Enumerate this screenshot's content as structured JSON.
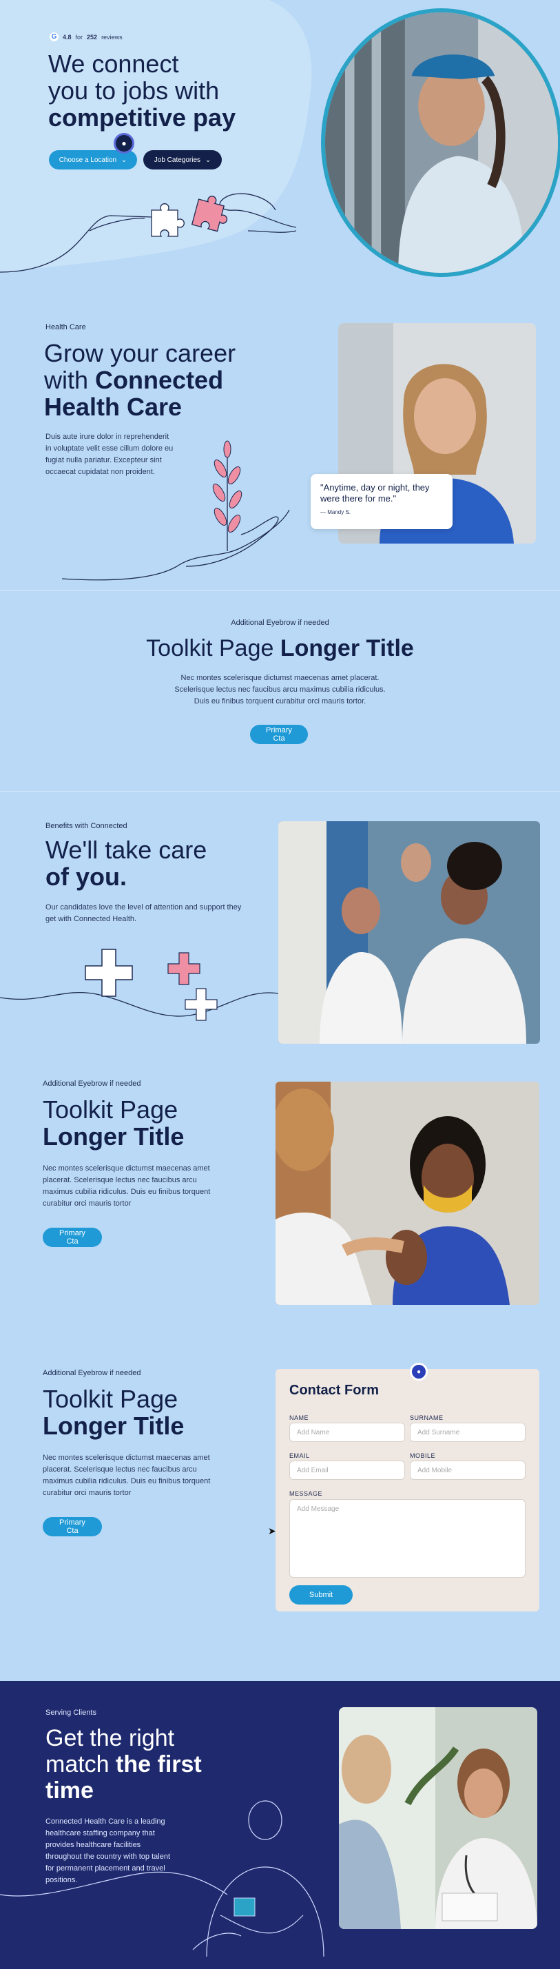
{
  "hero": {
    "rating": {
      "score": "4.8",
      "for_text": "for",
      "count": "252",
      "reviews_text": "reviews"
    },
    "title_line1": "We connect",
    "title_line2": "you to jobs with",
    "title_bold": "competitive pay",
    "location_button": "Choose a Location",
    "categories_button": "Job Categories"
  },
  "health": {
    "eyebrow": "Health Care",
    "title_line1": "Grow your career",
    "title_with": "with",
    "title_bold1": "Connected",
    "title_bold2": "Health Care",
    "body": "Duis aute irure dolor in reprehenderit in voluptate velit esse cillum dolore eu fugiat nulla pariatur. Excepteur sint occaecat cupidatat non proident.",
    "quote": "\"Anytime, day or night, they were there for me.\"",
    "quote_author": "— Mandy S."
  },
  "toolkit_center": {
    "eyebrow": "Additional Eyebrow if needed",
    "title_regular": "Toolkit Page",
    "title_bold": "Longer Title",
    "body_line1": "Nec montes scelerisque dictumst maecenas amet placerat.",
    "body_line2": "Scelerisque lectus nec faucibus arcu maximus cubilia ridiculus.",
    "body_line3": "Duis eu finibus torquent curabitur orci mauris tortor.",
    "cta": "Primary Cta"
  },
  "benefits": {
    "eyebrow": "Benefits with Connected",
    "title_line1": "We'll take care",
    "title_bold": "of you.",
    "body": "Our candidates love the level of attention and support they get with Connected Health."
  },
  "toolkit_left": {
    "eyebrow": "Additional Eyebrow if needed",
    "title_regular": "Toolkit Page",
    "title_bold": "Longer Title",
    "body": "Nec montes scelerisque dictumst maecenas amet placerat. Scelerisque lectus nec faucibus arcu maximus cubilia ridiculus. Duis eu finibus torquent curabitur orci mauris tortor",
    "cta": "Primary Cta"
  },
  "toolkit_form": {
    "eyebrow": "Additional Eyebrow if needed",
    "title_regular": "Toolkit Page",
    "title_bold": "Longer Title",
    "body": "Nec montes scelerisque dictumst maecenas amet placerat. Scelerisque lectus nec faucibus arcu maximus cubilia ridiculus. Duis eu finibus torquent curabitur orci mauris tortor",
    "cta": "Primary Cta"
  },
  "contact_form": {
    "title": "Contact Form",
    "name_label": "NAME",
    "name_placeholder": "Add Name",
    "surname_label": "SURNAME",
    "surname_placeholder": "Add Surname",
    "email_label": "EMAIL",
    "email_placeholder": "Add Email",
    "mobile_label": "MOBILE",
    "mobile_placeholder": "Add Mobile",
    "message_label": "MESSAGE",
    "message_placeholder": "Add Message",
    "submit": "Submit"
  },
  "serving": {
    "eyebrow": "Serving Clients",
    "title_line1": "Get the right",
    "title_line2_regular": "match",
    "title_line2_bold": "the first",
    "title_line3_bold": "time",
    "body": "Connected Health Care is a leading healthcare staffing company that provides healthcare facilities throughout the country with top talent for permanent placement and travel positions."
  },
  "icons": {
    "rating": "google-logo-icon",
    "assistant": "chat-assistant-icon",
    "dropdown": "chevron-down-icon",
    "cursor": "mouse-pointer-icon"
  },
  "colors": {
    "background": "#b9d9f6",
    "navy": "#13214a",
    "primary": "#1f9ad6",
    "dark_section": "#1f2a6e",
    "form_card": "#efe7e1",
    "pink": "#ee8fa4"
  }
}
